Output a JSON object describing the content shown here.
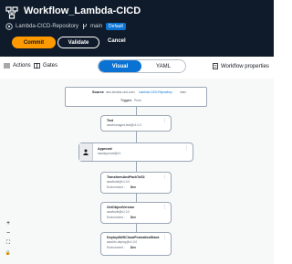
{
  "header": {
    "title": "Workflow_Lambda-CICD",
    "repository": "Lambda-CICD-Repository",
    "branch": "main",
    "badge": "Default"
  },
  "actions": {
    "commit": "Commit",
    "validate": "Validate",
    "cancel": "Cancel"
  },
  "toolbar": {
    "actions_label": "Actions",
    "gates_label": "Gates",
    "visual_label": "Visual",
    "yaml_label": "YAML",
    "properties_label": "Workflow properties"
  },
  "workflow": {
    "source": {
      "label": "Source",
      "connection": "aws-lambda-cicd-conn",
      "repo": "Lambda-CICD-Repository",
      "branch": "main",
      "trigger_label": "Triggers",
      "trigger_value": "Push"
    },
    "nodes": [
      {
        "name": "Test",
        "detail": "aws/managed-test@v1.0.0",
        "env_label": "",
        "env_value": ""
      },
      {
        "name": "Approval",
        "detail": "aws/approval@v1",
        "env_label": "",
        "env_value": ""
      },
      {
        "name": "TransformAndPackToS3",
        "detail": "aws/build@v1.0.0",
        "env_label": "Environment :",
        "env_value": "Dev"
      },
      {
        "name": "GetObjectVersion",
        "detail": "aws/build@v1.0.0",
        "env_label": "Environment :",
        "env_value": "Dev"
      },
      {
        "name": "DeployAWSCloudFormationStack",
        "detail": "aws/cfn-deploy@v1.0.0",
        "env_label": "Environment :",
        "env_value": "Dev"
      }
    ]
  },
  "zoom_controls": [
    "+",
    "−",
    "⛶",
    "🔒"
  ]
}
